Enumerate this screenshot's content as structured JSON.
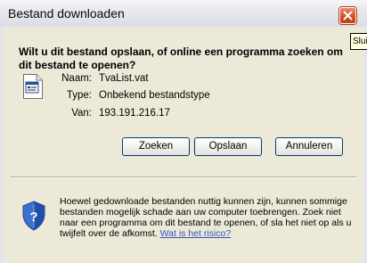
{
  "window": {
    "title": "Bestand downloaden",
    "close_tooltip": "Slui"
  },
  "dialog": {
    "question": "Wilt u dit bestand opslaan, of online een programma zoeken om dit bestand te openen?",
    "file_icon": "unknown-file-icon",
    "fields": [
      {
        "label": "Naam:",
        "value": "TvaList.vat"
      },
      {
        "label": "Type:",
        "value": "Onbekend bestandstype"
      },
      {
        "label": "Van:",
        "value": "193.191.216.17"
      }
    ],
    "buttons": {
      "search": "Zoeken",
      "save": "Opslaan",
      "cancel": "Annuleren"
    },
    "warning": {
      "icon": "security-shield-icon",
      "text": "Hoewel gedownloade bestanden nuttig kunnen zijn, kunnen sommige bestanden mogelijk schade aan uw computer toebrengen. Zoek niet naar een programma om dit bestand te openen, of sla het niet op als u twijfelt over de afkomst.",
      "link": "Wat is het risico?"
    }
  },
  "colors": {
    "dialog_bg": "#ece9d8",
    "close_button": "#cf4b22",
    "link": "#3355bb"
  }
}
